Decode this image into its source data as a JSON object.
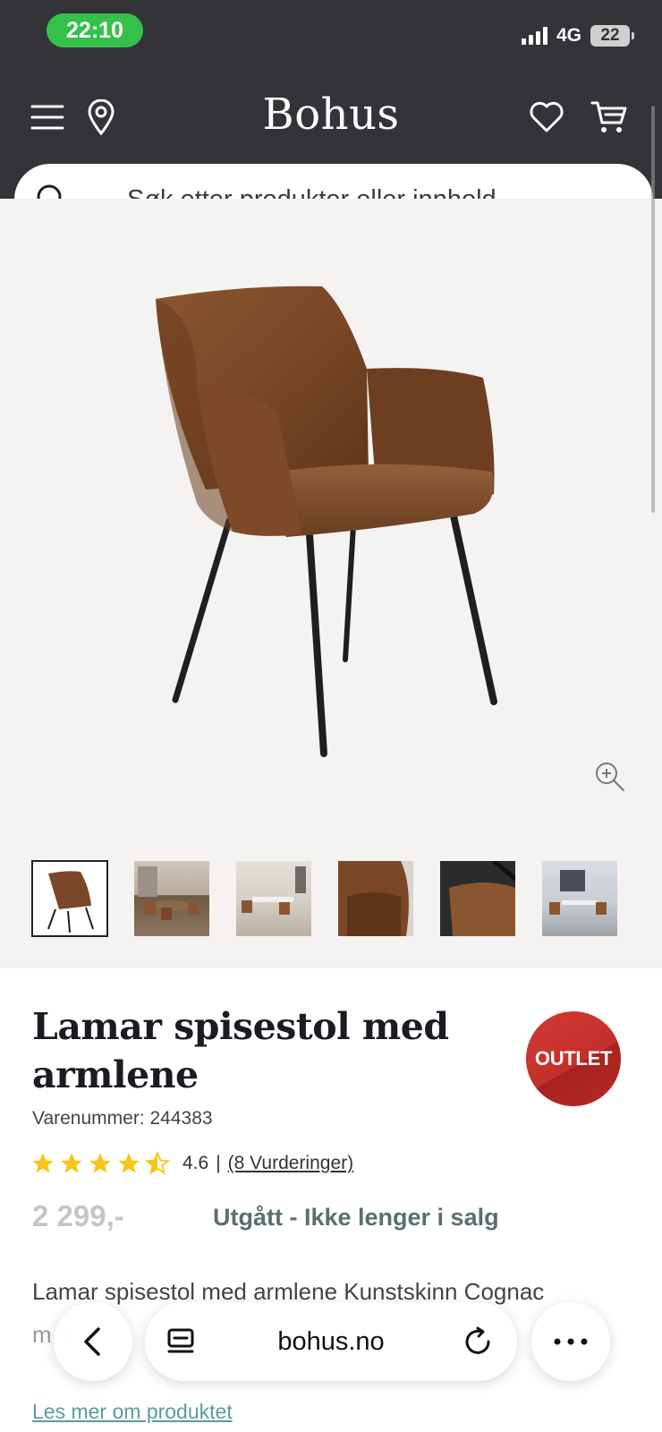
{
  "status_bar": {
    "time": "22:10",
    "network": "4G",
    "battery": "22"
  },
  "header": {
    "brand": "Bohus"
  },
  "search": {
    "placeholder": "Søk etter produkter eller innhold..."
  },
  "gallery": {
    "thumbnails": [
      "chair-cognac-front",
      "dining-room-scene-1",
      "dining-room-scene-2",
      "chair-back-closeup",
      "chair-side-closeup",
      "dining-room-scene-3"
    ],
    "active_index": 0
  },
  "product": {
    "title": "Lamar spisestol med armlene",
    "badge": "OUTLET",
    "sku": "Varenummer: 244383",
    "rating_value": "4.6",
    "rating_separator": "|",
    "rating_link": "(8 Vurderinger)",
    "rating_stars": 4.6,
    "price": "2 299,-",
    "availability": "Utgått - Ikke lenger i salg",
    "description_line1": "Lamar spisestol med armlene Kunstskinn Cognac",
    "description_line2": "m                   'c",
    "read_more": "Les mer om produktet"
  },
  "browser": {
    "url": "bohus.no"
  },
  "colors": {
    "header_bg": "#333338",
    "status_green": "#34c14a",
    "outlet_red": "#c4302c",
    "star": "#f5c518",
    "accent_teal": "#5a9c9c"
  }
}
